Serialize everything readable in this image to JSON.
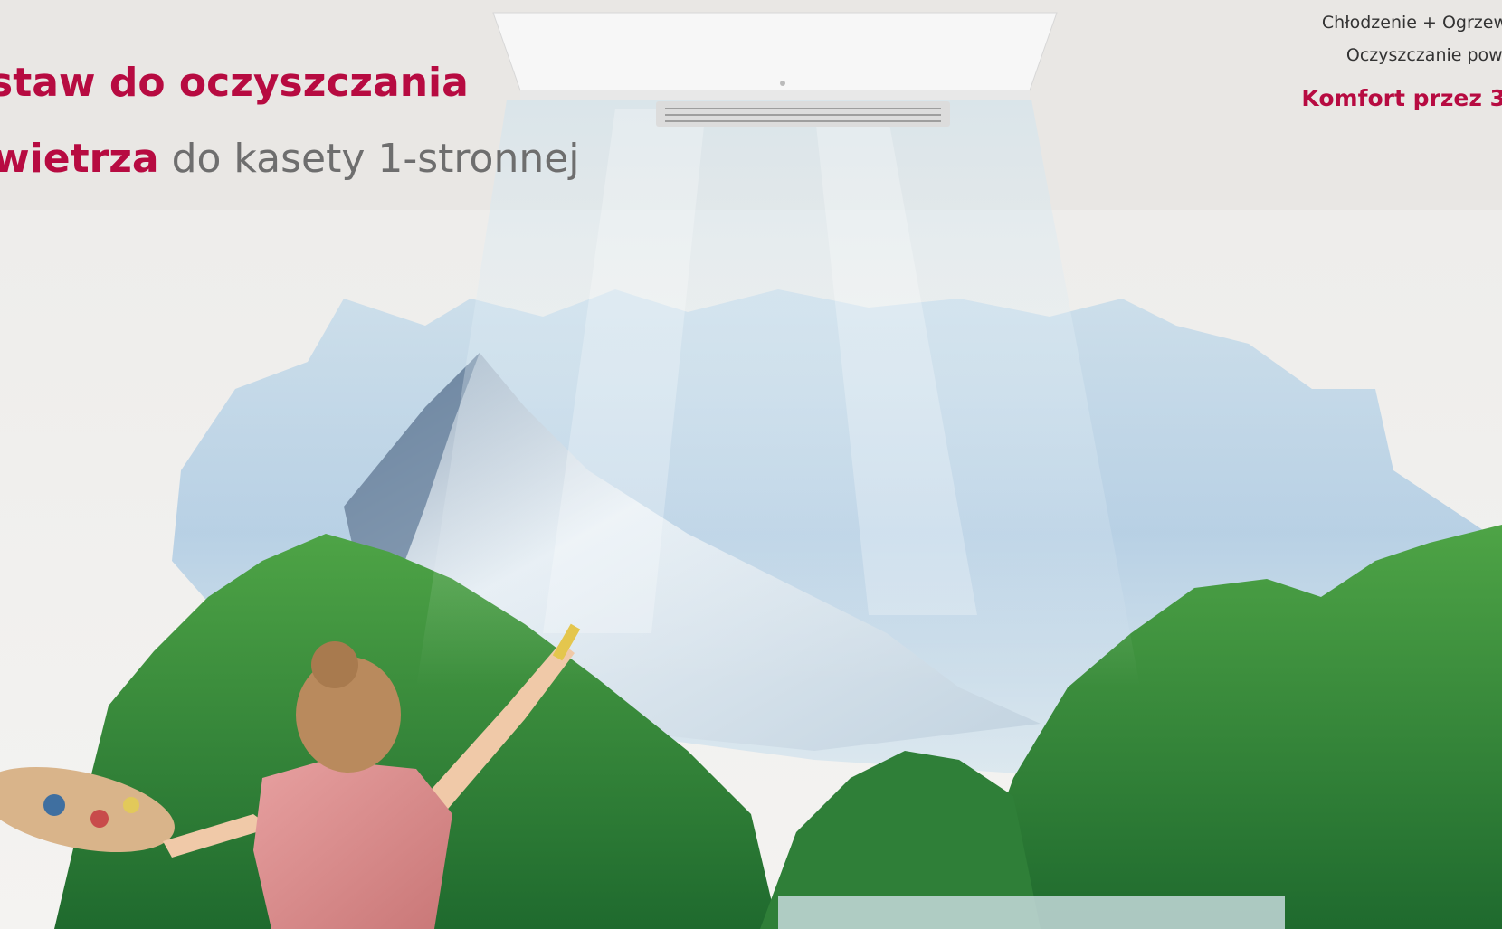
{
  "headline": {
    "line1_accent": "staw do oczyszczania",
    "line2_accent": "wietrza",
    "line2_rest": " do kasety 1-stronnej"
  },
  "features": {
    "item1": "Chłodzenie + Ogrzew",
    "item2": "Oczyszczanie powi",
    "item3": "Komfort przez 3"
  },
  "colors": {
    "accent": "#b70b41",
    "grey_text": "#6e6e6e",
    "wall": "#efeeec"
  }
}
